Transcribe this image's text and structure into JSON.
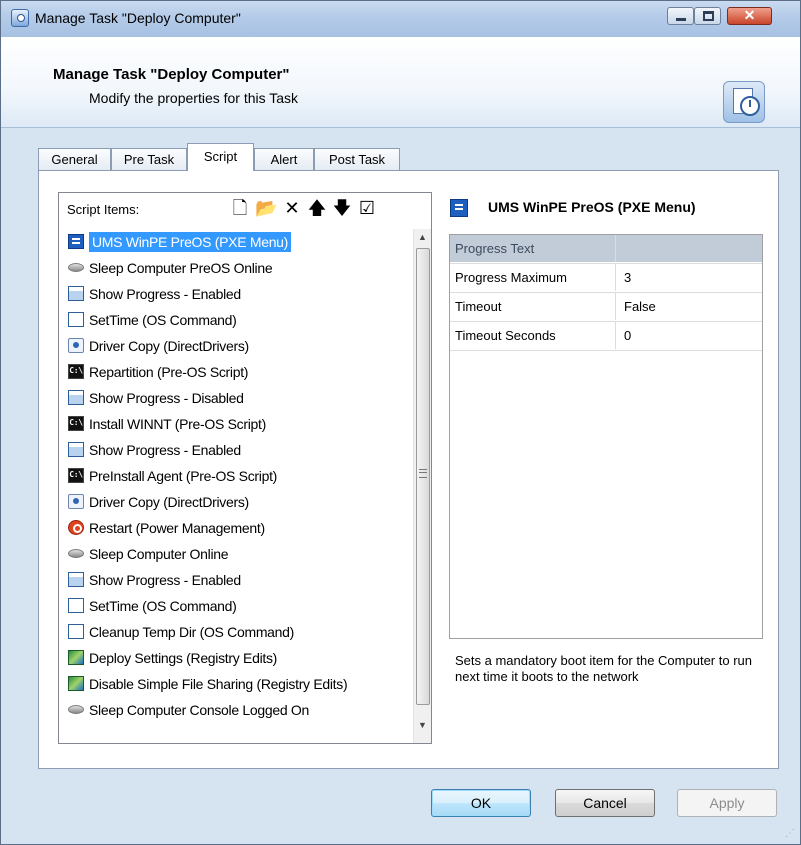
{
  "window": {
    "title": "Manage Task \"Deploy Computer\"",
    "close_glyph": "✕"
  },
  "header": {
    "title": "Manage Task \"Deploy Computer\"",
    "subtitle": "Modify the properties for this Task"
  },
  "tabs": [
    {
      "label": "General",
      "active": false
    },
    {
      "label": "Pre Task",
      "active": false
    },
    {
      "label": "Script",
      "active": true
    },
    {
      "label": "Alert",
      "active": false
    },
    {
      "label": "Post Task",
      "active": false
    }
  ],
  "script_list": {
    "label": "Script Items:",
    "toolbar": [
      {
        "icon": "new-document-icon",
        "glyph": "🗋"
      },
      {
        "icon": "open-folder-icon",
        "glyph": "📂"
      },
      {
        "icon": "delete-icon",
        "glyph": "✕"
      },
      {
        "icon": "move-up-icon",
        "glyph": "🡅"
      },
      {
        "icon": "move-down-icon",
        "glyph": "🡇"
      },
      {
        "icon": "properties-icon",
        "glyph": "☑"
      }
    ],
    "items": [
      {
        "text": "UMS WinPE PreOS (PXE Menu)",
        "icon": "pxe",
        "selected": true
      },
      {
        "text": "Sleep Computer PreOS Online",
        "icon": "sleep"
      },
      {
        "text": "Show Progress - Enabled",
        "icon": "progress"
      },
      {
        "text": "SetTime (OS Command)",
        "icon": "settime"
      },
      {
        "text": "Driver Copy (DirectDrivers)",
        "icon": "driver"
      },
      {
        "text": "Repartition (Pre-OS Script)",
        "icon": "cmd",
        "icon_text": "C:\\"
      },
      {
        "text": "Show Progress - Disabled",
        "icon": "progress"
      },
      {
        "text": "Install WINNT (Pre-OS Script)",
        "icon": "cmd",
        "icon_text": "C:\\"
      },
      {
        "text": "Show Progress - Enabled",
        "icon": "progress"
      },
      {
        "text": "PreInstall Agent (Pre-OS Script)",
        "icon": "cmd",
        "icon_text": "C:\\"
      },
      {
        "text": "Driver Copy (DirectDrivers)",
        "icon": "driver"
      },
      {
        "text": "Restart (Power Management)",
        "icon": "restart"
      },
      {
        "text": "Sleep Computer Online",
        "icon": "sleep"
      },
      {
        "text": "Show Progress - Enabled",
        "icon": "progress"
      },
      {
        "text": "SetTime (OS Command)",
        "icon": "settime"
      },
      {
        "text": "Cleanup Temp Dir (OS Command)",
        "icon": "settime"
      },
      {
        "text": "Deploy Settings (Registry Edits)",
        "icon": "registry"
      },
      {
        "text": "Disable Simple File Sharing (Registry Edits)",
        "icon": "registry"
      },
      {
        "text": "Sleep Computer Console Logged On",
        "icon": "sleep"
      }
    ]
  },
  "properties": {
    "title": "UMS WinPE PreOS (PXE Menu)",
    "rows": [
      {
        "key": "Progress Text",
        "value": "",
        "highlighted": true
      },
      {
        "key": "Progress Maximum",
        "value": "3"
      },
      {
        "key": "Timeout",
        "value": "False"
      },
      {
        "key": "Timeout Seconds",
        "value": "0"
      }
    ],
    "description": "Sets a mandatory boot item for the Computer to run next time it boots to the network"
  },
  "buttons": {
    "ok": "OK",
    "cancel": "Cancel",
    "apply": "Apply"
  }
}
